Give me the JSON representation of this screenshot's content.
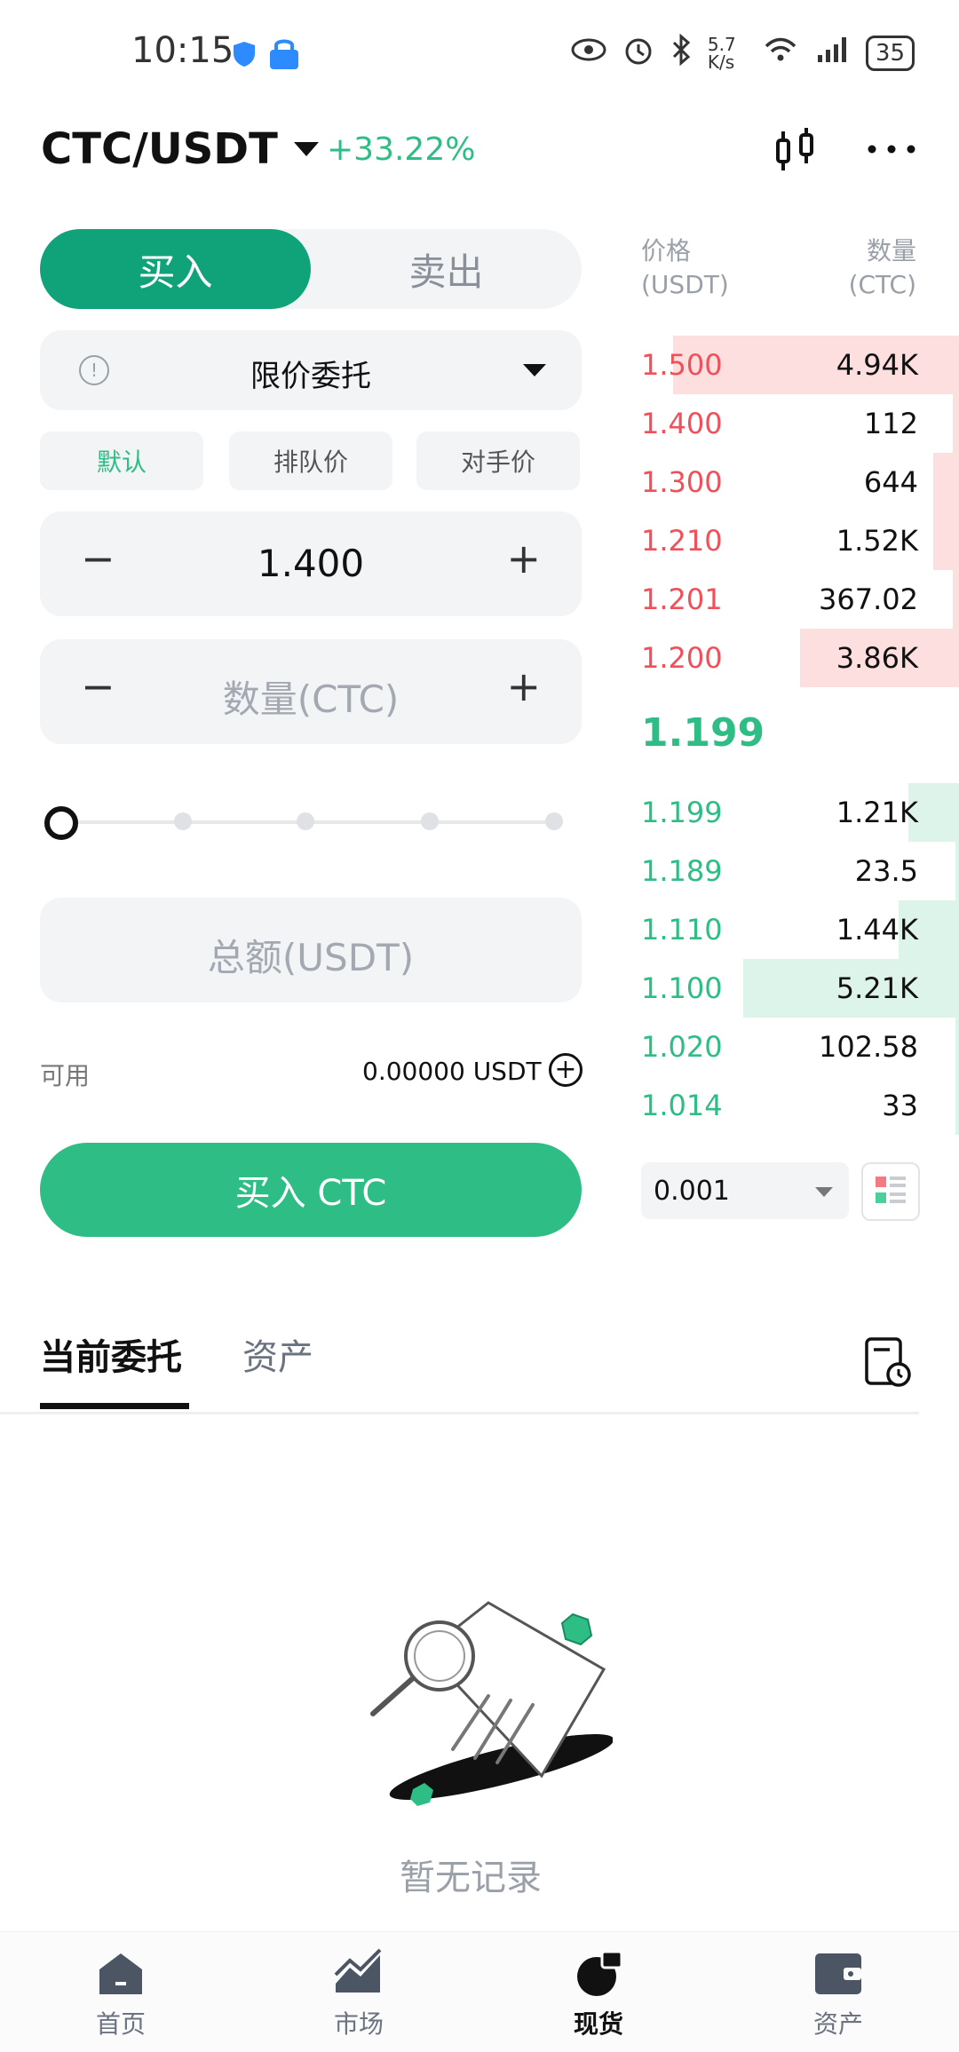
{
  "status_bar": {
    "time": "10:15",
    "network_speed": "5.7 K/s",
    "signal": "4G",
    "battery": "35"
  },
  "header": {
    "pair": "CTC/USDT",
    "change": "+33.22%"
  },
  "trade": {
    "buy_tab": "买入",
    "sell_tab": "卖出",
    "order_type": "限价委托",
    "chips": [
      "默认",
      "排队价",
      "对手价"
    ],
    "price_value": "1.400",
    "quantity_placeholder": "数量(CTC)",
    "total_placeholder": "总额(USDT)",
    "available_label": "可用",
    "available_value": "0.00000 USDT",
    "buy_button": "买入 CTC",
    "slider_percent": 0
  },
  "orderbook": {
    "price_header_1": "价格",
    "price_header_2": "(USDT)",
    "qty_header_1": "数量",
    "qty_header_2": "(CTC)",
    "asks": [
      {
        "price": "1.500",
        "qty": "4.94K",
        "depth": 0.9
      },
      {
        "price": "1.400",
        "qty": "112",
        "depth": 0.02
      },
      {
        "price": "1.300",
        "qty": "644",
        "depth": 0.08
      },
      {
        "price": "1.210",
        "qty": "1.52K",
        "depth": 0.08
      },
      {
        "price": "1.201",
        "qty": "367.02",
        "depth": 0.02
      },
      {
        "price": "1.200",
        "qty": "3.86K",
        "depth": 0.5
      }
    ],
    "last_price": "1.199",
    "bids": [
      {
        "price": "1.199",
        "qty": "1.21K",
        "depth": 0.16
      },
      {
        "price": "1.189",
        "qty": "23.5",
        "depth": 0.01
      },
      {
        "price": "1.110",
        "qty": "1.44K",
        "depth": 0.19
      },
      {
        "price": "1.100",
        "qty": "5.21K",
        "depth": 0.68
      },
      {
        "price": "1.020",
        "qty": "102.58",
        "depth": 0.01
      },
      {
        "price": "1.014",
        "qty": "33",
        "depth": 0.01
      }
    ],
    "precision": "0.001"
  },
  "tabs": {
    "current_orders": "当前委托",
    "assets": "资产"
  },
  "empty_state": "暂无记录",
  "bottom_nav": [
    {
      "label": "首页",
      "icon": "home-icon"
    },
    {
      "label": "市场",
      "icon": "market-chart-icon"
    },
    {
      "label": "现货",
      "icon": "spot-icon"
    },
    {
      "label": "资产",
      "icon": "wallet-icon"
    }
  ],
  "colors": {
    "green": "#2ebd85",
    "dark_green": "#10a37a",
    "red": "#f0505a",
    "ask_bg": "#fddfe0",
    "bid_bg": "#dcf4ea"
  }
}
